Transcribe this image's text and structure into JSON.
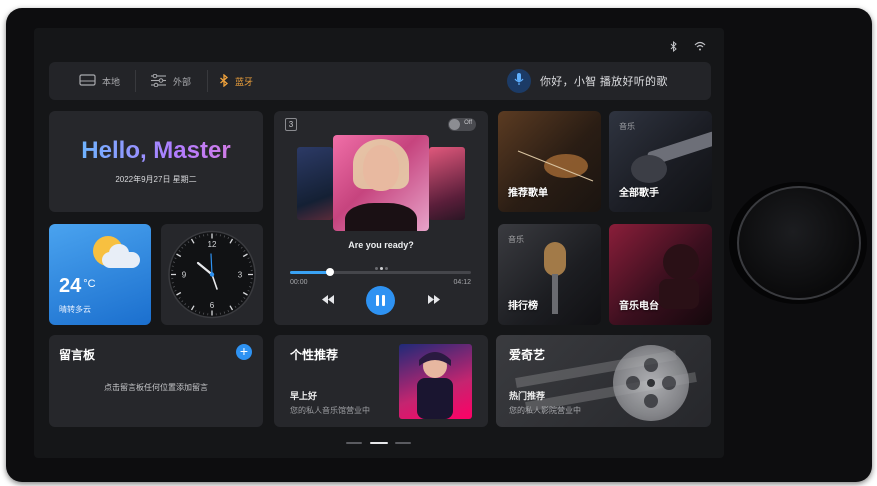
{
  "status_bar": {
    "bluetooth_icon": "bluetooth-icon",
    "wifi_icon": "wifi-icon"
  },
  "topbar": {
    "sources": [
      {
        "label": "本地",
        "icon": "local-drive-icon",
        "active": false
      },
      {
        "label": "外部",
        "icon": "sliders-icon",
        "active": false
      },
      {
        "label": "蓝牙",
        "icon": "bluetooth-icon",
        "active": true
      }
    ],
    "voice_prompt": "你好，小智 播放好听的歌",
    "accent_color": "#f0a23c"
  },
  "greeting": {
    "title": "Hello, Master",
    "date": "2022年9月27日 星期二"
  },
  "weather": {
    "temperature": "24",
    "unit": "°C",
    "description": "晴转多云"
  },
  "clock": {
    "numerals": [
      "12",
      "3",
      "6",
      "9"
    ]
  },
  "player": {
    "track_number": "3",
    "toggle_label": "Off",
    "song_title": "Are you ready?",
    "current_time": "00:00",
    "total_time": "04:12",
    "progress": 0.22,
    "page_dots": 3,
    "active_dot": 1
  },
  "tiles": [
    {
      "label": "推荐歌单",
      "tag": ""
    },
    {
      "label": "全部歌手",
      "tag": "音乐"
    },
    {
      "label": "排行榜",
      "tag": "音乐"
    },
    {
      "label": "音乐电台",
      "tag": ""
    }
  ],
  "message_board": {
    "title": "留言板",
    "hint": "点击留言板任何位置添加留言"
  },
  "recommendation": {
    "title": "个性推荐",
    "greeting": "早上好",
    "subtitle": "您的私人音乐馆营业中"
  },
  "iqiyi": {
    "title": "爱奇艺",
    "section": "热门推荐",
    "subtitle": "您的私人影院营业中"
  },
  "pager": {
    "pages": 3,
    "active": 1
  },
  "colors": {
    "primary_blue": "#2e92f2",
    "card_bg": "#26272b",
    "screen_bg": "#151618"
  }
}
